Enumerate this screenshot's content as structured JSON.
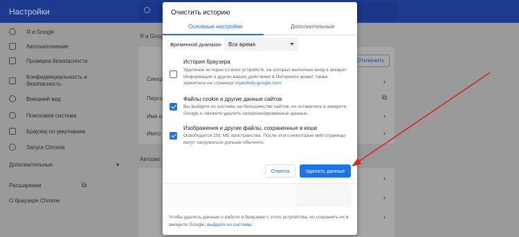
{
  "app": {
    "title": "Настройки"
  },
  "sidebar": {
    "items": [
      {
        "label": "Я и Google",
        "icon": "person-icon"
      },
      {
        "label": "Автозаполнение",
        "icon": "clipboard-icon"
      },
      {
        "label": "Проверка безопасности",
        "icon": "shield-check-icon"
      },
      {
        "label": "Конфиденциальность и безопасность",
        "icon": "shield-icon"
      },
      {
        "label": "Внешний вид",
        "icon": "palette-icon"
      },
      {
        "label": "Поисковая система",
        "icon": "search-icon"
      },
      {
        "label": "Браузер по умолчанию",
        "icon": "browser-icon"
      },
      {
        "label": "Запуск Chrome",
        "icon": "power-icon"
      }
    ],
    "advanced": "Дополнительные",
    "extensions": "Расширения",
    "about": "О браузере Chrome"
  },
  "main": {
    "section_you_google": "Я и Google",
    "disconnect": "Отключить",
    "rows": [
      "Синхр",
      "Персо",
      "Имя и",
      "Импо"
    ],
    "section_autofill": "Автозап"
  },
  "dialog": {
    "title": "Очистить историю",
    "tabs": [
      "Основные настройки",
      "Дополнительные"
    ],
    "range_label": "Временной диапазон",
    "range_value": "Все время",
    "options": [
      {
        "title": "История браузера",
        "checked": false,
        "desc": "Удаление истории со всех устройств, на которых выполнен вход в аккаунт. Информация о других ваших действиях в Интернете может также храниться на странице",
        "link": "myactivity.google.com."
      },
      {
        "title": "Файлы cookie и другие данные сайтов",
        "checked": true,
        "desc": "Вы выйдете из системы на большинстве сайтов, но останетесь в аккаунте Google и сможете удалить синхронизированные данные."
      },
      {
        "title": "Изображения и другие файлы, сохраненные в кеше",
        "checked": true,
        "desc": "Освободится 191 МБ пространства. После этого некоторые веб-страницы могут загружаться дольше обычного."
      }
    ],
    "cancel": "Отмена",
    "delete": "Удалить данные",
    "footer_text": "Чтобы удалить данные о работе в браузере с этого устройства, но сохранить их в аккаунте Google,",
    "footer_link": "выйдите из системы."
  },
  "colors": {
    "topbar": "#1c3b8f",
    "accent": "#1a73e8",
    "arrow": "#e0221c"
  }
}
